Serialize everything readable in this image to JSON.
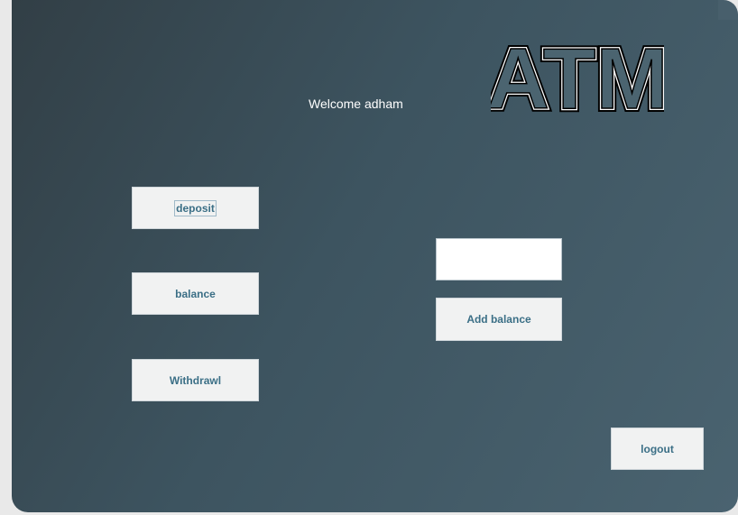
{
  "welcome": {
    "text": "Welcome adham"
  },
  "logo": {
    "text": "ATM"
  },
  "buttons": {
    "deposit": "deposit",
    "balance": "balance",
    "withdraw": "Withdrawl",
    "add_balance": "Add balance",
    "logout": "logout"
  },
  "amount_input": {
    "value": ""
  },
  "colors": {
    "background_start": "#323f46",
    "background_end": "#4a6370",
    "button_bg": "#f1f2f2",
    "button_text": "#3b6f86",
    "welcome_text": "#ffffff"
  }
}
